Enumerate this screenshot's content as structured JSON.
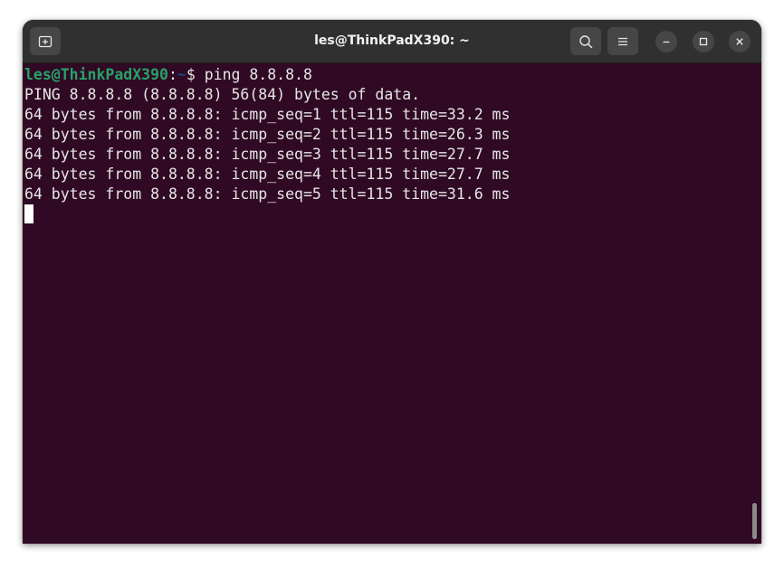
{
  "window": {
    "title": "les@ThinkPadX390: ~"
  },
  "toolbar": {
    "new_tab_icon": "new-tab-icon",
    "search_icon": "search-icon",
    "menu_icon": "hamburger-menu-icon",
    "minimize_icon": "minimize-icon",
    "maximize_icon": "maximize-icon",
    "close_icon": "close-icon"
  },
  "terminal": {
    "prompt": {
      "user_host": "les@ThinkPadX390",
      "colon": ":",
      "path": "~",
      "symbol": "$",
      "command": " ping 8.8.8.8"
    },
    "output": [
      "PING 8.8.8.8 (8.8.8.8) 56(84) bytes of data.",
      "64 bytes from 8.8.8.8: icmp_seq=1 ttl=115 time=33.2 ms",
      "64 bytes from 8.8.8.8: icmp_seq=2 ttl=115 time=26.3 ms",
      "64 bytes from 8.8.8.8: icmp_seq=3 ttl=115 time=27.7 ms",
      "64 bytes from 8.8.8.8: icmp_seq=4 ttl=115 time=27.7 ms",
      "64 bytes from 8.8.8.8: icmp_seq=5 ttl=115 time=31.6 ms"
    ]
  },
  "colors": {
    "terminal_background": "#300a24",
    "titlebar_background": "#303030",
    "prompt_user": "#26a269",
    "prompt_path": "#12488b",
    "text": "#e6e6e6"
  }
}
